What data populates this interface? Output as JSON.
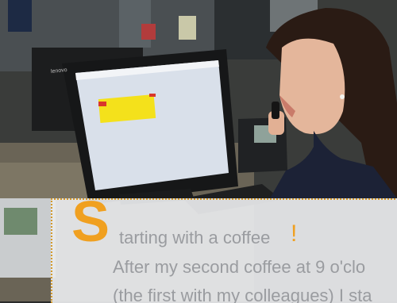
{
  "caption": {
    "drop_cap": "S",
    "title_rest": "tarting with a coffee",
    "exclamation": "!",
    "line1": "After my second coffee at 9 o'clo",
    "line2": "(the first with my colleagues) I sta"
  },
  "monitor": {
    "brand": "lenovo"
  },
  "colors": {
    "accent_orange": "#f0a020",
    "caption_text": "#9a9ca0"
  }
}
